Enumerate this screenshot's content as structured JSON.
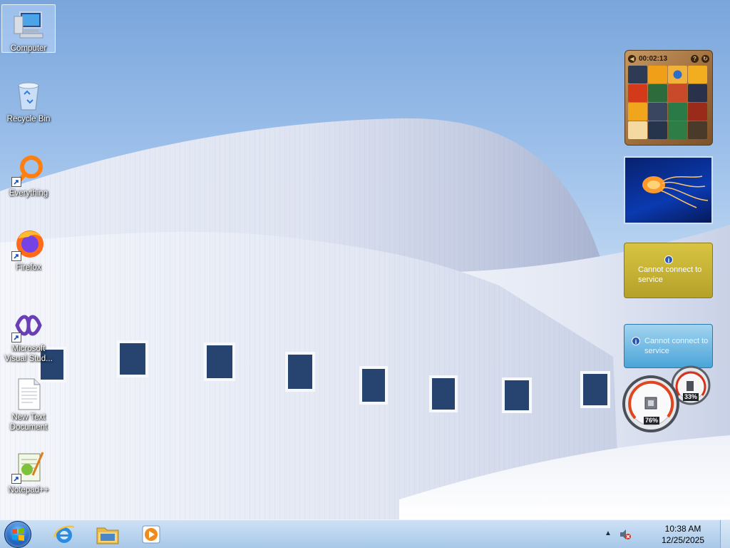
{
  "desktop": {
    "icons": [
      {
        "label": "Computer",
        "icon": "computer-icon"
      },
      {
        "label": "Recycle Bin",
        "icon": "recycle-bin-icon"
      },
      {
        "label": "Everything",
        "icon": "everything-search-icon"
      },
      {
        "label": "Firefox",
        "icon": "firefox-icon"
      },
      {
        "label": "Microsoft Visual Stud...",
        "icon": "visual-studio-icon"
      },
      {
        "label": "New Text Document",
        "icon": "text-document-icon"
      },
      {
        "label": "Notepad++",
        "icon": "notepad-plus-plus-icon"
      }
    ]
  },
  "gadgets": {
    "puzzle": {
      "timer": "00:02:13"
    },
    "weather": {
      "message": "Cannot connect to service"
    },
    "feed": {
      "message": "Cannot connect to service"
    },
    "cpu_meter": {
      "cpu": "76%",
      "memory": "33%"
    }
  },
  "taskbar": {
    "pinned": [
      {
        "name": "Internet Explorer",
        "icon": "internet-explorer-icon"
      },
      {
        "name": "Windows Explorer",
        "icon": "folder-icon"
      },
      {
        "name": "Windows Media Player",
        "icon": "media-player-icon"
      }
    ],
    "clock": {
      "time": "10:38 AM",
      "date": "12/25/2025"
    }
  },
  "colors": {
    "sky_top": "#7aa6dc",
    "taskbar": "#b8d1ec",
    "weather_gadget": "#c8b438",
    "feed_gadget": "#6ab7e2",
    "puzzle_frame": "#a8763f"
  }
}
